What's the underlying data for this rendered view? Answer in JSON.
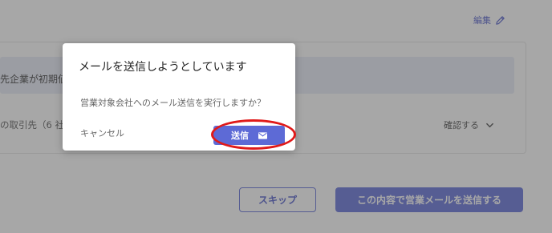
{
  "page": {
    "edit_label": "編集",
    "alert_text": "先企業が初期値",
    "recipients_text": "の取引先（6 社",
    "confirm_label": "確認する",
    "skip_label": "スキップ",
    "primary_send_label": "この内容で営業メールを送信する"
  },
  "dialog": {
    "title": "メールを送信しようとしています",
    "message": "営業対象会社へのメール送信を実行しますか？",
    "cancel_label": "キャンセル",
    "send_label": "送信"
  },
  "icons": {
    "edit": "pencil-icon",
    "confirm": "chevron-down-icon",
    "send": "envelope-icon"
  },
  "colors": {
    "accent": "#5d6ad6",
    "highlight": "#e01a1a",
    "alert_background": "#e7eaf6"
  }
}
